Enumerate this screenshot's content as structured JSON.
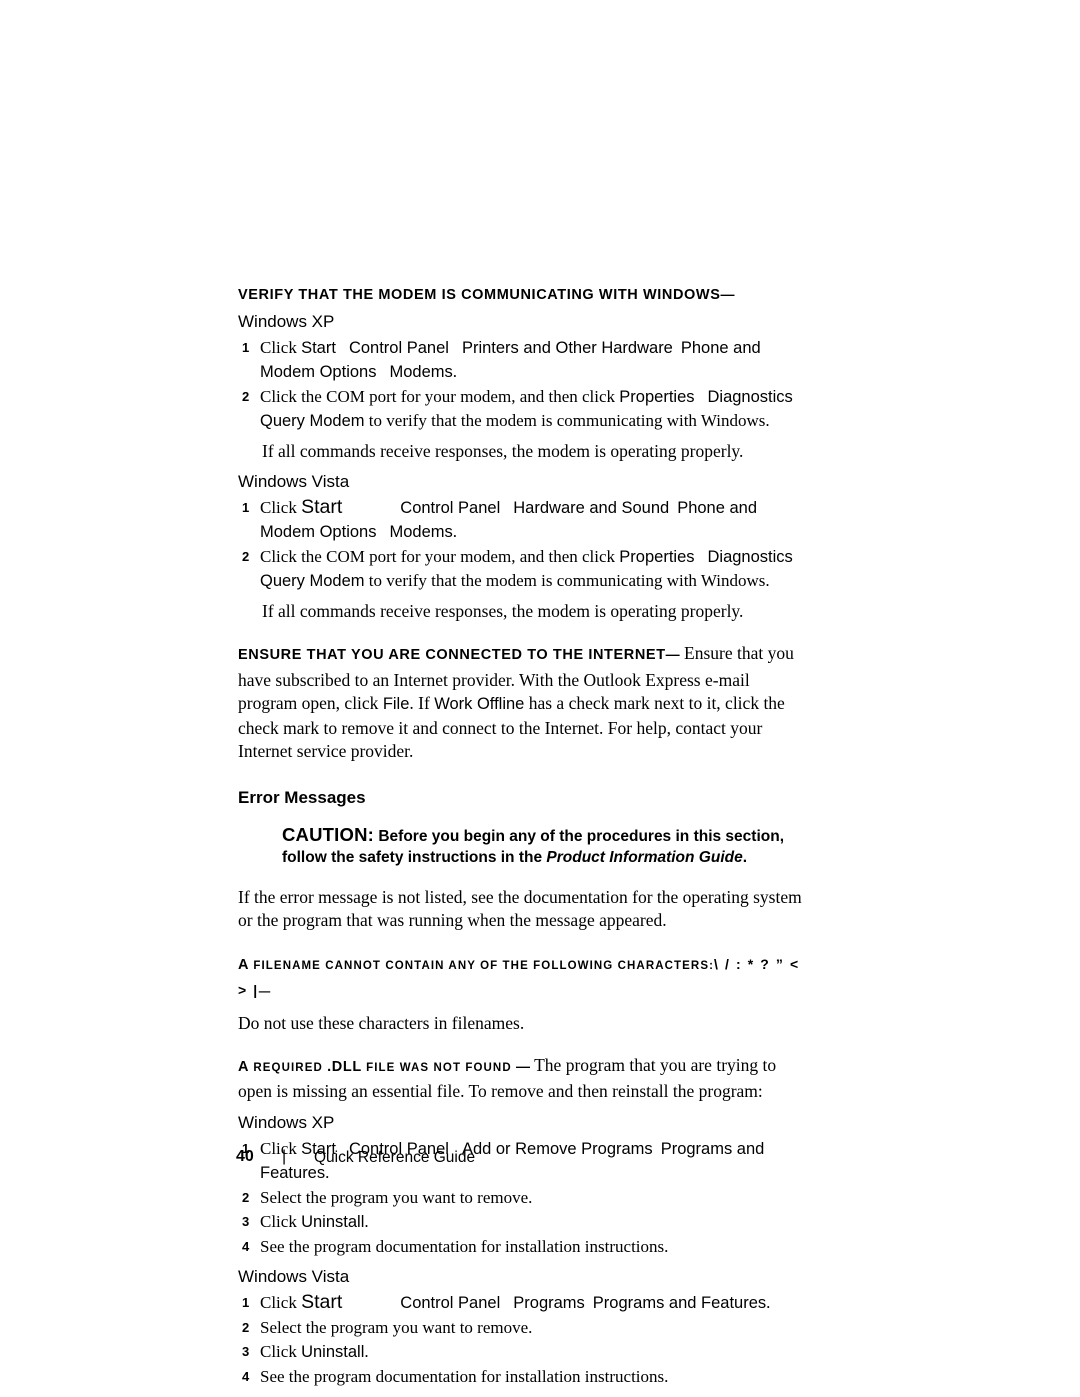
{
  "page": {
    "number": "40",
    "footer_separator": "|",
    "footer_title": "Quick Reference Guide"
  },
  "modem_check": {
    "heading_main": "Verify that the modem is communicating with ",
    "heading_last": "Windows",
    "heading_dash": "—",
    "xp": {
      "label": "Windows XP",
      "steps": [
        {
          "num": "1",
          "lead": "Click ",
          "ui1": "Start",
          "ui2": "Control Panel",
          "ui3": "Printers and Other Hardware",
          "ui4": "Phone and Modem Options",
          "ui5": "Modems",
          "tail": "."
        },
        {
          "num": "2",
          "lead": "Click the COM port for your modem, and then click ",
          "ui1": "Properties",
          "ui2": "Diagnostics",
          "ui3": "Query Modem",
          "tail": " to verify that the modem is communicating with Windows."
        }
      ],
      "note": "If all commands receive responses, the modem is operating properly."
    },
    "vista": {
      "label": "Windows Vista",
      "steps": [
        {
          "num": "1",
          "lead": "Click ",
          "ui1": "Start",
          "ui2": "Control Panel",
          "ui3": "Hardware and Sound",
          "ui4": "Phone and Modem Options",
          "ui5": "Modems",
          "tail": "."
        },
        {
          "num": "2",
          "lead": "Click the COM port for your modem, and then click ",
          "ui1": "Properties",
          "ui2": "Diagnostics",
          "ui3": "Query Modem",
          "tail": " to verify that the modem is communicating with Windows."
        }
      ],
      "note": "If all commands receive responses, the modem is operating properly."
    }
  },
  "internet_check": {
    "heading_main": "Ensure that you are connected to the ",
    "heading_last": "Internet",
    "heading_dash": "—",
    "text_1": " Ensure that you have subscribed to an Internet provider. With the Outlook Express e-mail program open, click ",
    "ui_file": "File",
    "text_2": ". If ",
    "ui_work_offline": "Work Offline",
    "text_3": " has a check mark next to it, click the check mark to remove it and connect to the Internet. For help, contact your Internet service provider."
  },
  "error_messages": {
    "section_title": "Error Messages",
    "caution": {
      "keyword": "CAUTION:",
      "text_1": " Before you begin any of the procedures in this section, follow the safety instructions in the ",
      "italic_title": "Product Information Guide",
      "text_2": "."
    },
    "intro": "If the error message is not listed, see the documentation for the operating system or the program that was running when the message appeared.",
    "filename_error": {
      "heading_a": "A",
      "heading_main": " filename cannot contain any of the following characters:",
      "characters": "\\ / : * ? ” < > |",
      "heading_dash": "—",
      "body": "Do not use these characters in filenames."
    },
    "dll_error": {
      "heading_a": "A",
      "heading_main_1": " required ",
      "heading_dll": ".DLL",
      "heading_main_2": " file was not found ",
      "heading_dash": "—",
      "text": " The program that you are trying to open is missing an essential file. To remove and then reinstall the program:",
      "xp": {
        "label": "Windows XP",
        "steps": [
          {
            "num": "1",
            "lead": "Click ",
            "ui1": "Start",
            "ui2": "Control Panel",
            "ui3": "Add or Remove Programs",
            "ui4": "Programs and Features",
            "tail": "."
          },
          {
            "num": "2",
            "lead": "Select the program you want to remove.",
            "ui1": "",
            "tail": ""
          },
          {
            "num": "3",
            "lead": "Click ",
            "ui1": "Uninstall",
            "tail": "."
          },
          {
            "num": "4",
            "lead": "See the program documentation for installation instructions.",
            "ui1": "",
            "tail": ""
          }
        ]
      },
      "vista": {
        "label": "Windows Vista",
        "steps": [
          {
            "num": "1",
            "lead": "Click ",
            "ui1": "Start",
            "ui2": "Control Panel",
            "ui3": "Programs",
            "ui4": "Programs and Features",
            "tail": "."
          },
          {
            "num": "2",
            "lead": "Select the program you want to remove.",
            "ui1": "",
            "tail": ""
          },
          {
            "num": "3",
            "lead": "Click ",
            "ui1": "Uninstall",
            "tail": "."
          },
          {
            "num": "4",
            "lead": "See the program documentation for installation instructions.",
            "ui1": "",
            "tail": ""
          }
        ]
      }
    }
  }
}
